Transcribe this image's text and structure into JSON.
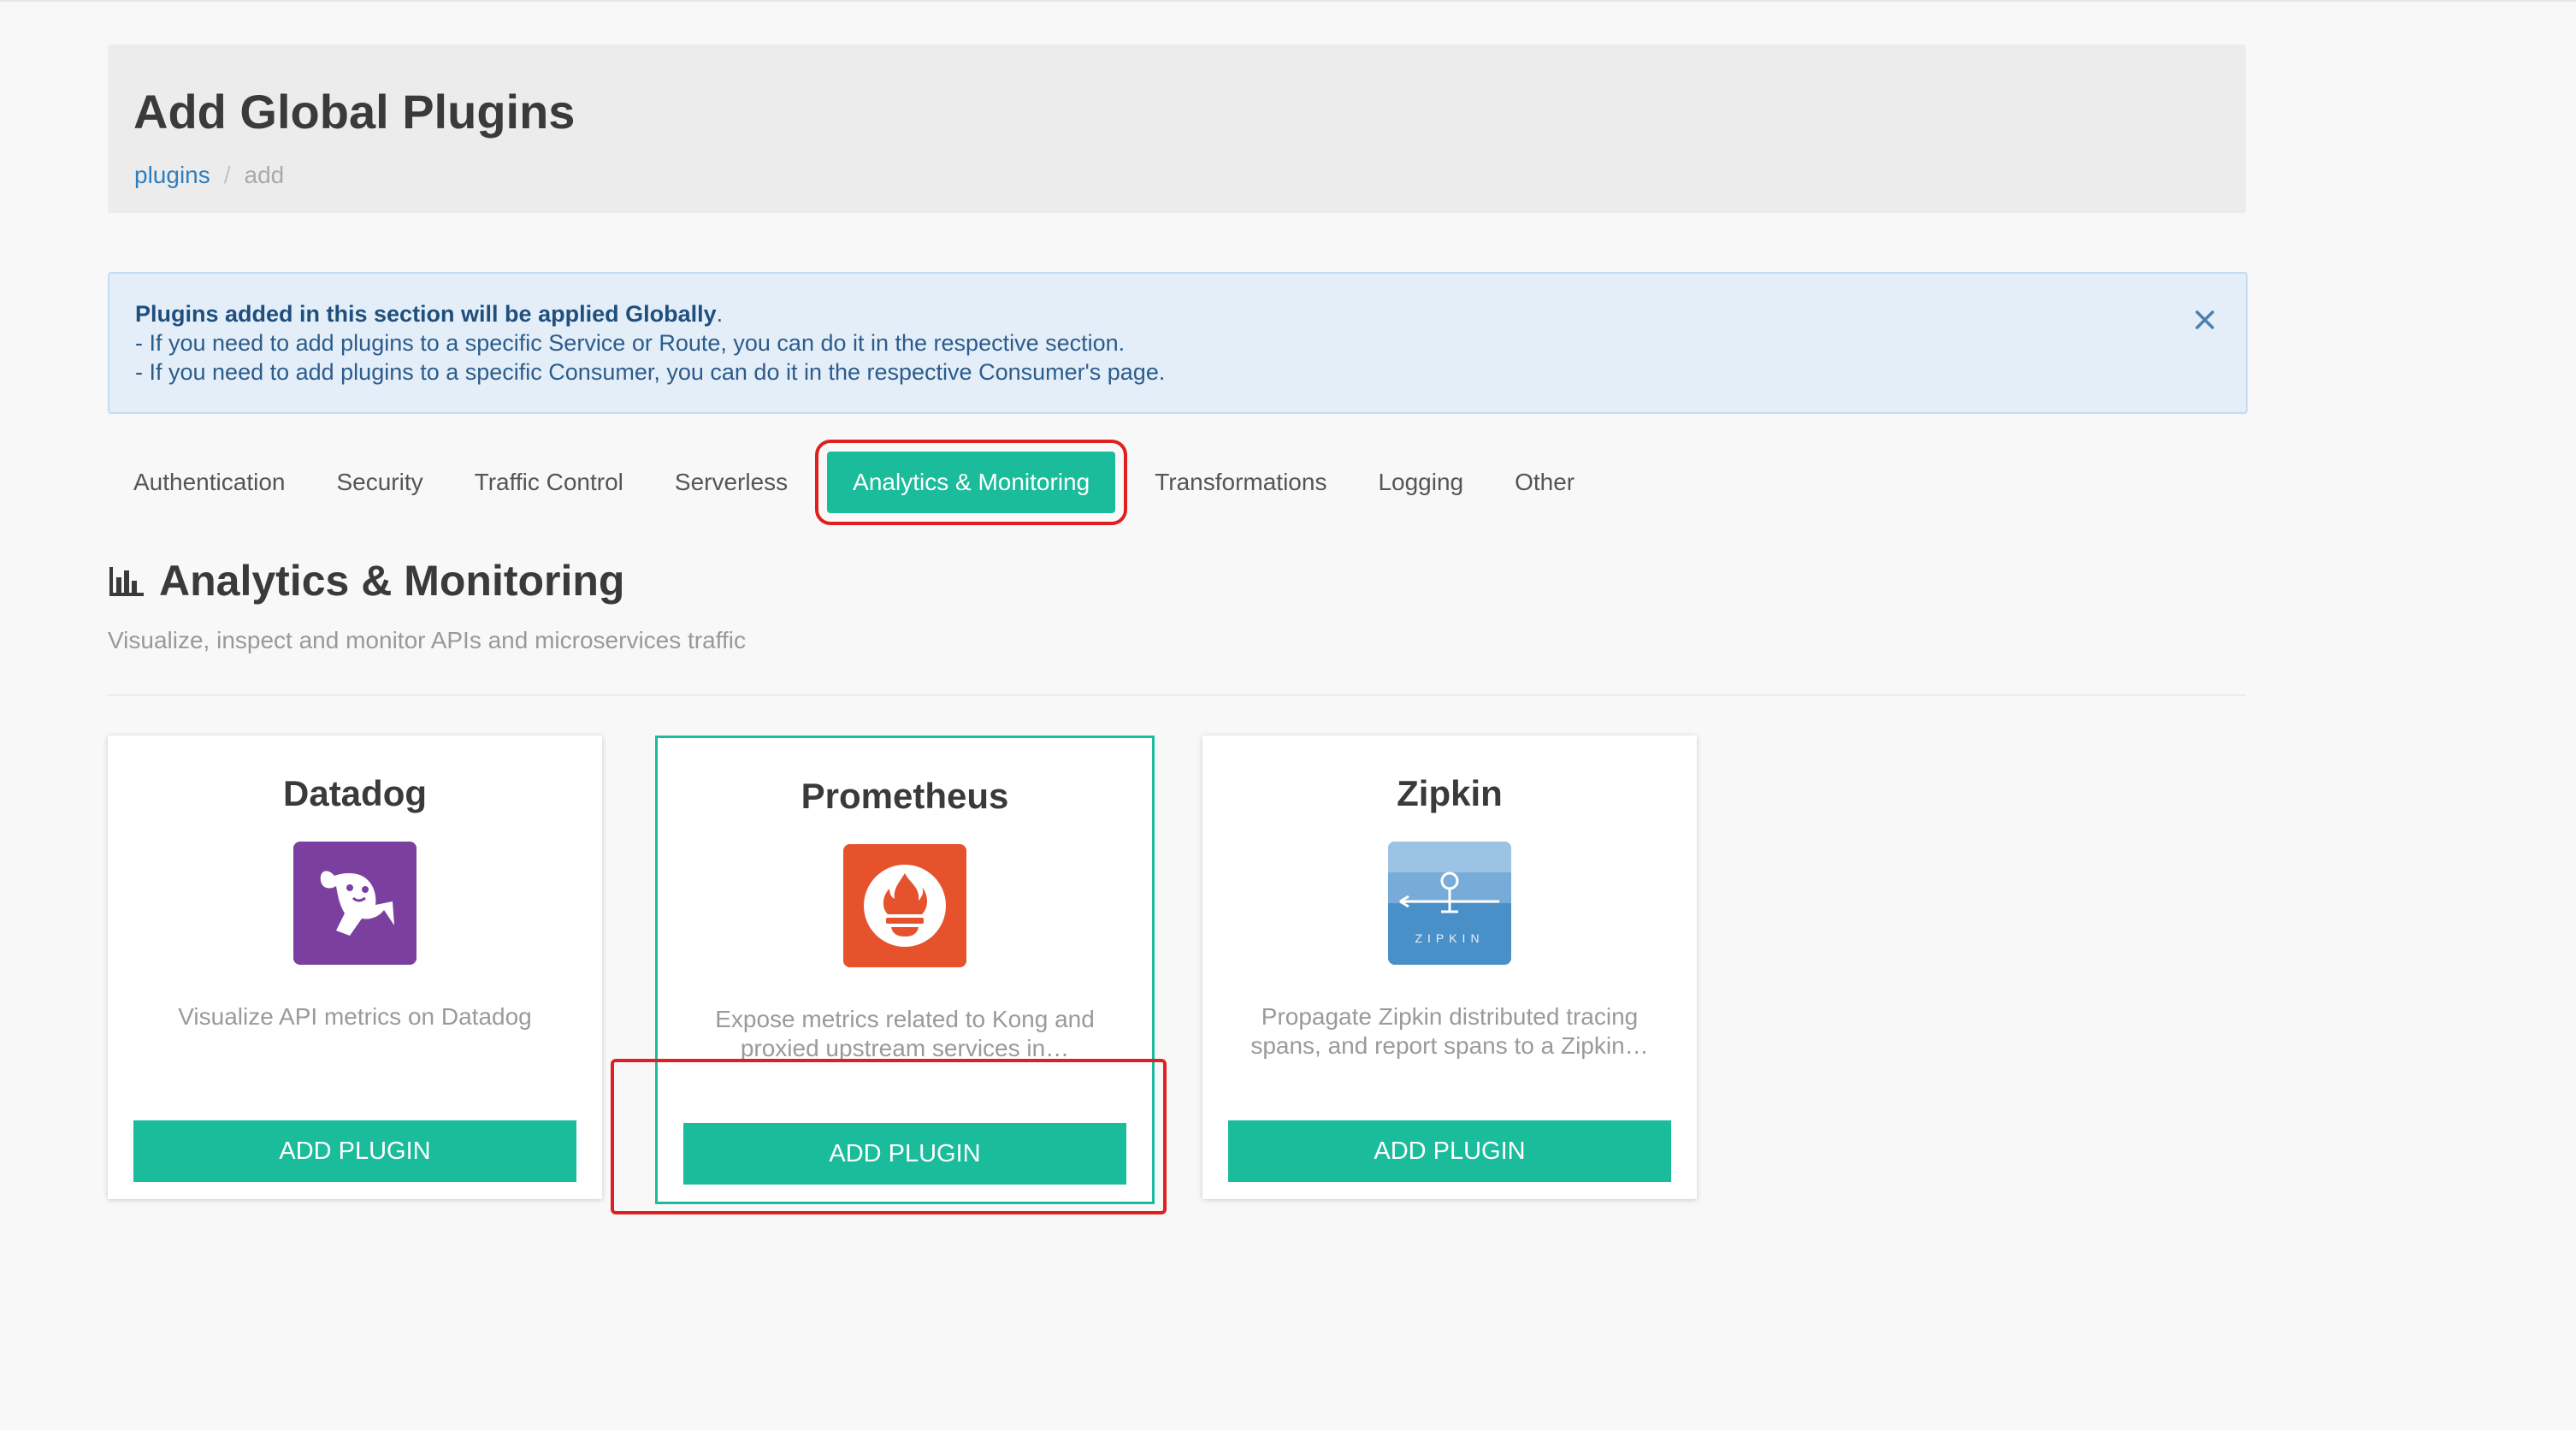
{
  "header": {
    "title": "Add Global Plugins",
    "breadcrumb": {
      "link": "plugins",
      "separator": "/",
      "current": "add"
    }
  },
  "alert": {
    "strong": "Plugins added in this section will be applied Globally",
    "strong_suffix": ".",
    "line1": "- If you need to add plugins to a specific Service or Route, you can do it in the respective section.",
    "line2": "- If you need to add plugins to a specific Consumer, you can do it in the respective Consumer's page.",
    "close_icon": "close-icon"
  },
  "tabs": [
    {
      "label": "Authentication"
    },
    {
      "label": "Security"
    },
    {
      "label": "Traffic Control"
    },
    {
      "label": "Serverless"
    },
    {
      "label": "Analytics & Monitoring",
      "active": true
    },
    {
      "label": "Transformations"
    },
    {
      "label": "Logging"
    },
    {
      "label": "Other"
    }
  ],
  "section": {
    "icon": "bar-chart-icon",
    "title": "Analytics & Monitoring",
    "subtitle": "Visualize, inspect and monitor APIs and microservices traffic"
  },
  "cards": [
    {
      "title": "Datadog",
      "description": "Visualize API metrics on Datadog",
      "button": "ADD PLUGIN",
      "logo_color": "#7b3fa0"
    },
    {
      "title": "Prometheus",
      "description": "Expose metrics related to Kong and proxied upstream services in…",
      "button": "ADD PLUGIN",
      "logo_color": "#e6522c"
    },
    {
      "title": "Zipkin",
      "description": "Propagate Zipkin distributed tracing spans, and report spans to a Zipkin…",
      "button": "ADD PLUGIN",
      "logo_color": "#4a90c8",
      "logo_text": "ZIPKIN"
    }
  ],
  "colors": {
    "accent": "#1abc9c",
    "link": "#2e7fbf",
    "annotation": "#e02020"
  }
}
